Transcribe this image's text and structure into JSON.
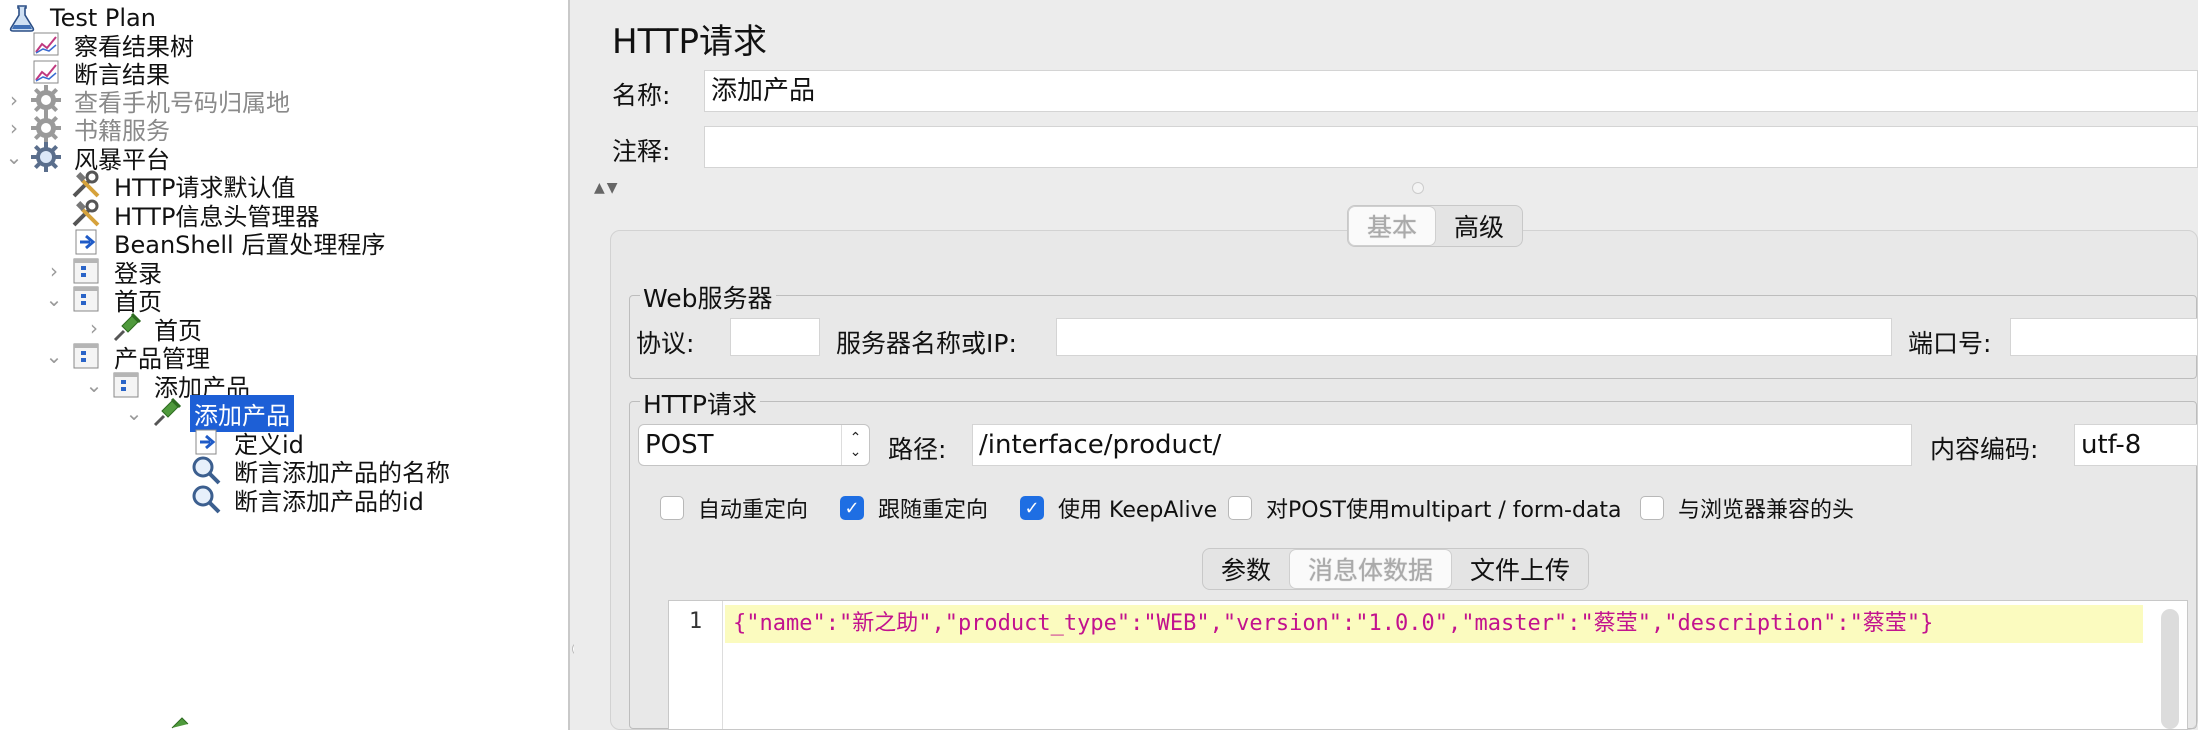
{
  "tree": {
    "items": [
      {
        "label": "Test Plan",
        "icon": "flask-icon",
        "state": "normal"
      },
      {
        "label": "察看结果树",
        "icon": "graph-icon",
        "state": "normal"
      },
      {
        "label": "断言结果",
        "icon": "graph-icon",
        "state": "normal"
      },
      {
        "label": "查看手机号码归属地",
        "icon": "gear-icon",
        "state": "disabled"
      },
      {
        "label": "书籍服务",
        "icon": "gear-icon",
        "state": "disabled"
      },
      {
        "label": "风暴平台",
        "icon": "gear-icon",
        "state": "normal"
      },
      {
        "label": "HTTP请求默认值",
        "icon": "tools-icon",
        "state": "normal"
      },
      {
        "label": "HTTP信息头管理器",
        "icon": "tools-icon",
        "state": "normal"
      },
      {
        "label": "BeanShell 后置处理程序",
        "icon": "script-icon",
        "state": "normal"
      },
      {
        "label": "登录",
        "icon": "controller-icon",
        "state": "normal"
      },
      {
        "label": "首页",
        "icon": "controller-icon",
        "state": "normal"
      },
      {
        "label": "首页",
        "icon": "sampler-icon",
        "state": "normal"
      },
      {
        "label": "产品管理",
        "icon": "controller-icon",
        "state": "normal"
      },
      {
        "label": "添加产品",
        "icon": "controller-icon",
        "state": "normal"
      },
      {
        "label": "添加产品",
        "icon": "sampler-icon",
        "state": "selected"
      },
      {
        "label": "定义id",
        "icon": "script-icon",
        "state": "normal"
      },
      {
        "label": "断言添加产品的名称",
        "icon": "magnifier-icon",
        "state": "normal"
      },
      {
        "label": "断言添加产品的id",
        "icon": "magnifier-icon",
        "state": "normal"
      }
    ]
  },
  "main": {
    "title": "HTTP请求",
    "name_label": "名称:",
    "name_value": "添加产品",
    "comment_label": "注释:",
    "comment_value": "",
    "tabs": [
      "基本",
      "高级"
    ],
    "active_tab": "基本",
    "web_server": {
      "title": "Web服务器",
      "protocol_label": "协议:",
      "protocol_value": "",
      "server_label": "服务器名称或IP:",
      "server_value": "",
      "port_label": "端口号:",
      "port_value": ""
    },
    "http_request": {
      "title": "HTTP请求",
      "method": "POST",
      "path_label": "路径:",
      "path_value": "/interface/product/",
      "encoding_label": "内容编码:",
      "encoding_value": "utf-8",
      "checkboxes": [
        {
          "label": "自动重定向",
          "checked": false
        },
        {
          "label": "跟随重定向",
          "checked": true
        },
        {
          "label": "使用 KeepAlive",
          "checked": true
        },
        {
          "label": "对POST使用multipart / form-data",
          "checked": false
        },
        {
          "label": "与浏览器兼容的头",
          "checked": false
        }
      ],
      "body_tabs": [
        "参数",
        "消息体数据",
        "文件上传"
      ],
      "active_body_tab": "消息体数据",
      "body_line_number": "1",
      "body_text": "{\"name\":\"新之助\",\"product_type\":\"WEB\",\"version\":\"1.0.0\",\"master\":\"蔡莹\",\"description\":\"蔡莹\"}"
    }
  },
  "colors": {
    "selection": "#1d5fd6",
    "checkbox_on": "#1e6ee3",
    "editor_line": "#fbfbbf",
    "json_text": "#c2128e"
  }
}
